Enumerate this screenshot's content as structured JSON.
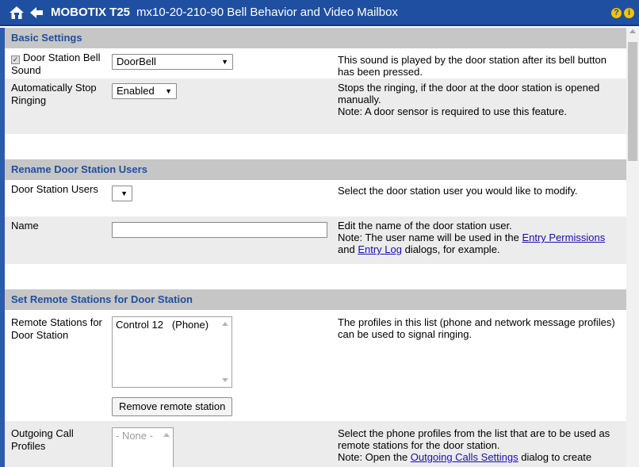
{
  "header": {
    "brand": "MOBOTIX T25",
    "subtitle": "mx10-20-210-90 Bell Behavior and Video Mailbox",
    "help": "?",
    "info": "i"
  },
  "sections": {
    "basic": {
      "title": "Basic Settings",
      "bell_sound": {
        "label": "Door Station Bell Sound",
        "checked_glyph": "✓",
        "value": "DoorBell",
        "desc": "This sound is played by the door station after its bell button has been pressed."
      },
      "auto_stop": {
        "label": "Automatically Stop Ringing",
        "value": "Enabled",
        "desc1": "Stops the ringing, if the door at the door station is opened manually.",
        "desc2": "Note: A door sensor is required to use this feature."
      }
    },
    "rename": {
      "title": "Rename Door Station Users",
      "users": {
        "label": "Door Station Users",
        "value": "",
        "desc": "Select the door station user you would like to modify."
      },
      "name": {
        "label": "Name",
        "value": "",
        "desc1": "Edit the name of the door station user.",
        "desc2_pre": "Note: The user name will be used in the ",
        "link1": "Entry Permissions",
        "desc2_mid": " and ",
        "link2": "Entry Log",
        "desc2_post": " dialogs, for example."
      }
    },
    "remote": {
      "title": "Set Remote Stations for Door Station",
      "stations": {
        "label": "Remote Stations for Door Station",
        "list_item": "Control 12   (Phone)",
        "remove_button": "Remove remote station",
        "desc": "The profiles in this list (phone and network message profiles) can be used to signal ringing."
      },
      "outgoing": {
        "label": "Outgoing Call Profiles",
        "list_item": "- None -",
        "desc1": "Select the phone profiles from the list that are to be used as remote stations for the door station.",
        "desc2_pre": "Note: Open the ",
        "link": "Outgoing Calls Settings",
        "desc2_post": " dialog to create"
      }
    }
  },
  "arrow_glyph": "▼"
}
